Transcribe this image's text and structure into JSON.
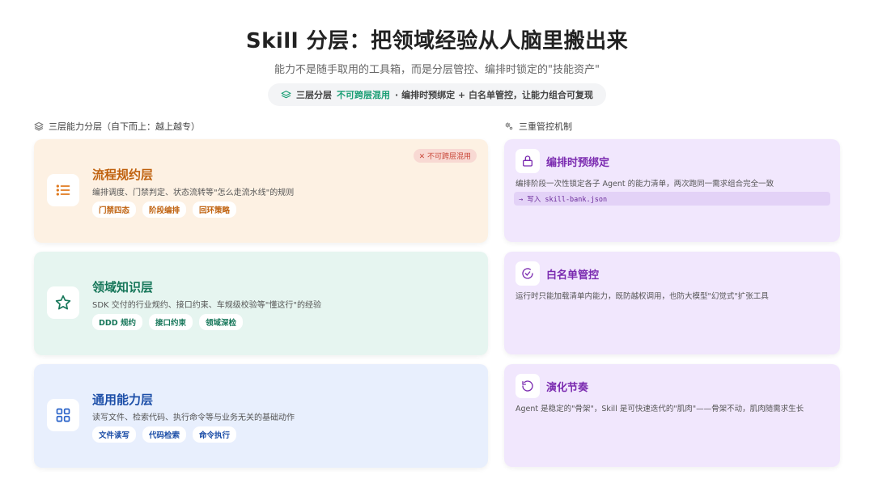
{
  "header": {
    "title": "Skill 分层：把领域经验从人脑里搬出来",
    "subtitle": "能力不是随手取用的工具箱，而是分层管控、编排时锁定的\"技能资产\"",
    "pill": {
      "icon": "layers-icon",
      "part1": "三层分层",
      "accent": "不可跨层混用",
      "part2": "· 编排时预绑定 + 白名单管控，让能力组合可复现"
    }
  },
  "left": {
    "section_label": "三层能力分层（自下而上：越上越专）",
    "section_icon": "layers-icon",
    "layers": [
      {
        "icon": "list-icon",
        "name": "流程规约层",
        "desc": "编排调度、门禁判定、状态流转等\"怎么走流水线\"的规则",
        "badge": "✕ 不可跨层混用",
        "tags": [
          "门禁四态",
          "阶段编排",
          "回环策略"
        ],
        "color": "#c0620f"
      },
      {
        "icon": "star-icon",
        "name": "领域知识层",
        "desc": "SDK 交付的行业规约、接口约束、车规级校验等\"懂这行\"的经验",
        "tags": [
          "DDD 规约",
          "接口约束",
          "领域深检"
        ],
        "color": "#17775a"
      },
      {
        "icon": "grid-icon",
        "name": "通用能力层",
        "desc": "读写文件、检索代码、执行命令等与业务无关的基础动作",
        "tags": [
          "文件读写",
          "代码检索",
          "命令执行"
        ],
        "color": "#1d4fa8"
      }
    ]
  },
  "right": {
    "section_label": "三重管控机制",
    "section_icon": "gears-icon",
    "controls": [
      {
        "icon": "lock-icon",
        "name": "编排时预绑定",
        "desc": "编排阶段一次性锁定各子 Agent 的能力清单，两次跑同一需求组合完全一致",
        "code": "→ 写入 skill-bank.json"
      },
      {
        "icon": "check-circle-icon",
        "name": "白名单管控",
        "desc": "运行时只能加载清单内能力，既防越权调用，也防大模型\"幻觉式\"扩张工具"
      },
      {
        "icon": "refresh-icon",
        "name": "演化节奏",
        "desc": "Agent 是稳定的\"骨架\"，Skill 是可快速迭代的\"肌肉\"——骨架不动，肌肉随需求生长"
      }
    ]
  },
  "colors": {
    "accent_green": "#1a9e74",
    "purple": "#7b2bb0",
    "orange": "#c0620f",
    "blue": "#1d4fa8"
  }
}
